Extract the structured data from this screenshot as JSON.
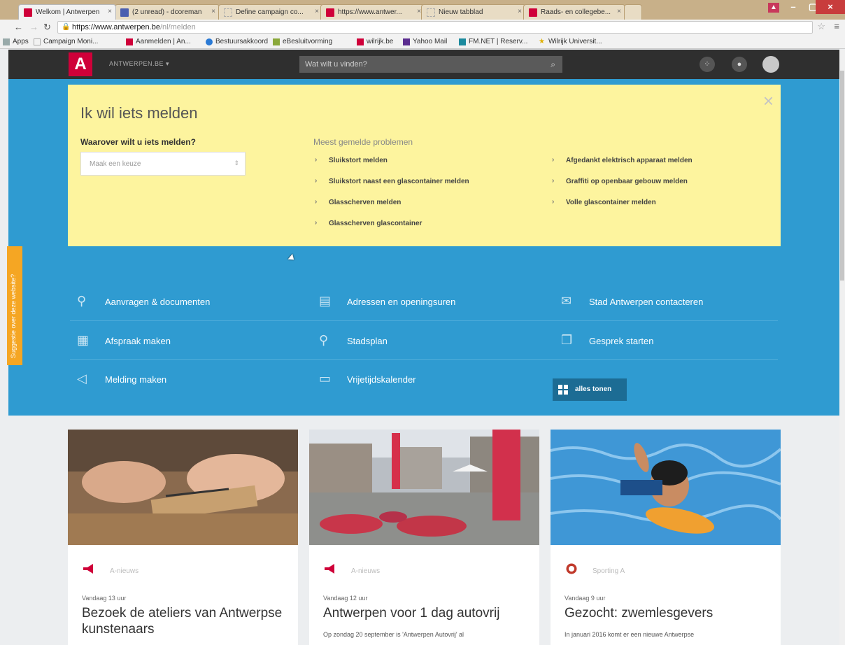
{
  "browser": {
    "tabs": [
      {
        "label": "Welkom | Antwerpen",
        "icon": "antwerpen-favicon"
      },
      {
        "label": "(2 unread) - dcoreman",
        "icon": "yahoo-mail-favicon"
      },
      {
        "label": "Define campaign co...",
        "icon": "page-favicon"
      },
      {
        "label": "https://www.antwer...",
        "icon": "antwerpen-favicon"
      },
      {
        "label": "Nieuw tabblad",
        "icon": "blank-favicon"
      },
      {
        "label": "Raads- en collegebe...",
        "icon": "antwerpen-favicon"
      }
    ],
    "url_host": "https://www.antwerpen.be",
    "url_path": "/nl/melden",
    "bookmarks": [
      {
        "label": "Apps"
      },
      {
        "label": "Campaign Moni..."
      },
      {
        "label": "Aanmelden | An..."
      },
      {
        "label": "Bestuursakkoord"
      },
      {
        "label": "eBesluitvorming"
      },
      {
        "label": "wilrijk.be"
      },
      {
        "label": "Yahoo Mail"
      },
      {
        "label": "FM.NET | Reserv..."
      },
      {
        "label": "Wilrijk Universit..."
      }
    ]
  },
  "site": {
    "logo": "A",
    "menu_label": "ANTWERPEN.BE",
    "search_placeholder": "Wat wilt u vinden?"
  },
  "melden": {
    "title": "Ik wil iets melden",
    "question": "Waarover wilt u iets melden?",
    "select_placeholder": "Maak een keuze",
    "popular_heading": "Meest gemelde problemen",
    "links": [
      "Sluikstort melden",
      "Sluikstort naast een glascontainer melden",
      "Glasscherven melden",
      "Glasscherven glascontainer",
      "Afgedankt elektrisch apparaat melden",
      "Graffiti op openbaar gebouw melden",
      "Volle glascontainer melden"
    ]
  },
  "feedback_tab": "Suggestie over deze website?",
  "quick_links": [
    {
      "label": "Aanvragen & documenten",
      "icon": "location-pin-icon"
    },
    {
      "label": "Adressen en openingsuren",
      "icon": "building-icon"
    },
    {
      "label": "Stad Antwerpen contacteren",
      "icon": "envelope-icon"
    },
    {
      "label": "Afspraak maken",
      "icon": "calendar-icon"
    },
    {
      "label": "Stadsplan",
      "icon": "map-pin-icon"
    },
    {
      "label": "Gesprek starten",
      "icon": "chat-icon"
    },
    {
      "label": "Melding maken",
      "icon": "megaphone-icon"
    },
    {
      "label": "Vrijetijdskalender",
      "icon": "ticket-icon"
    }
  ],
  "show_all": "alles tonen",
  "news": [
    {
      "category": "A-nieuws",
      "time": "Vandaag 13 uur",
      "title": "Bezoek de ateliers van Antwerpse kunstenaars",
      "excerpt": ""
    },
    {
      "category": "A-nieuws",
      "time": "Vandaag 12 uur",
      "title": "Antwerpen voor 1 dag autovrij",
      "excerpt": "Op zondag 20 september is 'Antwerpen Autovrij' al"
    },
    {
      "category": "Sporting A",
      "time": "Vandaag 9 uur",
      "title": "Gezocht: zwemlesgevers",
      "excerpt": "In januari 2016 komt er een nieuwe Antwerpse"
    }
  ],
  "colors": {
    "brand_red": "#cf0039",
    "blue": "#2f9bd1",
    "yellow": "#fdf49e",
    "orange": "#f5a623"
  }
}
